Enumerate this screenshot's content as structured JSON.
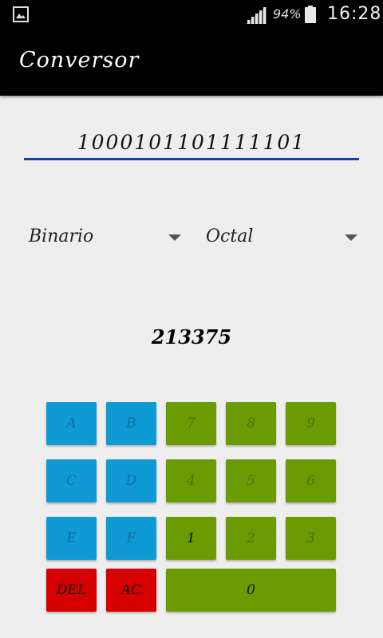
{
  "status_bar": {
    "battery_text": "94%",
    "time": "16:28",
    "icons": [
      "gallery-notification-icon",
      "signal-icon",
      "battery-icon"
    ]
  },
  "app_bar": {
    "title": "Conversor"
  },
  "input": {
    "value": "1000101101111101"
  },
  "from_spinner": {
    "selected": "Binario"
  },
  "to_spinner": {
    "selected": "Octal"
  },
  "result": {
    "value": "213375"
  },
  "keypad": {
    "keys": [
      {
        "label": "A",
        "color": "blue",
        "enabled": false
      },
      {
        "label": "B",
        "color": "blue",
        "enabled": false
      },
      {
        "label": "7",
        "color": "green",
        "enabled": false
      },
      {
        "label": "8",
        "color": "green",
        "enabled": false
      },
      {
        "label": "9",
        "color": "green",
        "enabled": false
      },
      {
        "label": "C",
        "color": "blue",
        "enabled": false
      },
      {
        "label": "D",
        "color": "blue",
        "enabled": false
      },
      {
        "label": "4",
        "color": "green",
        "enabled": false
      },
      {
        "label": "5",
        "color": "green",
        "enabled": false
      },
      {
        "label": "6",
        "color": "green",
        "enabled": false
      },
      {
        "label": "E",
        "color": "blue",
        "enabled": false
      },
      {
        "label": "F",
        "color": "blue",
        "enabled": false
      },
      {
        "label": "1",
        "color": "green",
        "enabled": true
      },
      {
        "label": "2",
        "color": "green",
        "enabled": false
      },
      {
        "label": "3",
        "color": "green",
        "enabled": false
      },
      {
        "label": "DEL",
        "color": "red",
        "enabled": true
      },
      {
        "label": "AC",
        "color": "red",
        "enabled": true
      },
      {
        "label": "0",
        "color": "green",
        "enabled": true
      }
    ]
  },
  "colors": {
    "blue_key": "#0f9ad3",
    "green_key": "#6a9c02",
    "red_key": "#d60000",
    "underline": "#1a3db0"
  }
}
